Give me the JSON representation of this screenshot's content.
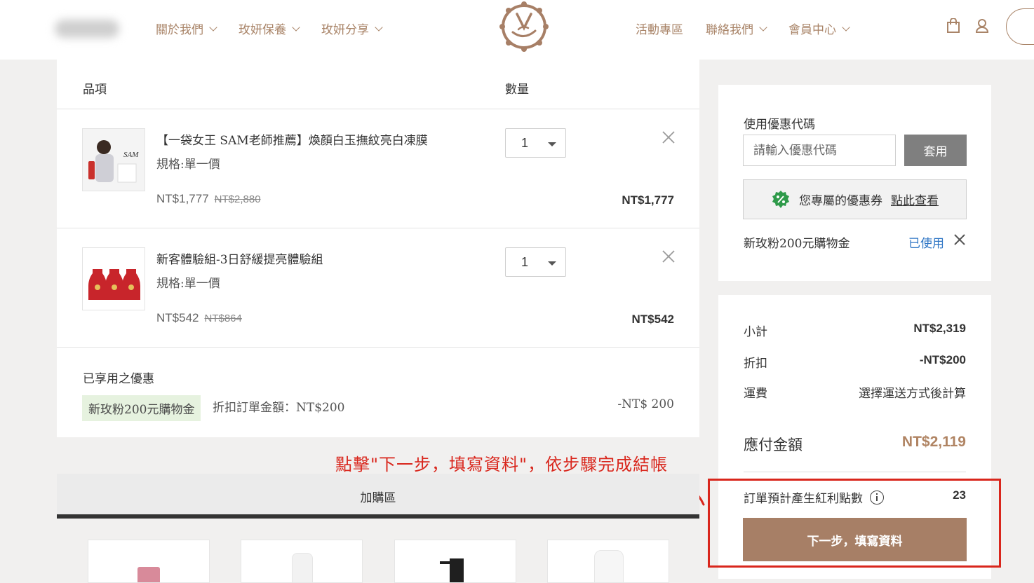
{
  "header": {
    "nav_left": [
      {
        "label": "關於我們"
      },
      {
        "label": "玫妍保養"
      },
      {
        "label": "玫妍分享"
      }
    ],
    "nav_right": [
      {
        "label": "活動專區"
      },
      {
        "label": "聯絡我們"
      },
      {
        "label": "會員中心"
      }
    ]
  },
  "cart": {
    "col_item": "品項",
    "col_qty": "數量",
    "items": [
      {
        "name": "【一袋女王 SAM老師推薦】煥顏白玉撫紋亮白凍膜",
        "spec": "規格:單一價",
        "price": "NT$1,777",
        "original_price": "NT$2,880",
        "qty": "1",
        "line_total": "NT$1,777",
        "thumb_text": "SAM"
      },
      {
        "name": "新客體驗組-3日舒緩提亮體驗組",
        "spec": "規格:單一價",
        "price": "NT$542",
        "original_price": "NT$864",
        "qty": "1",
        "line_total": "NT$542"
      }
    ],
    "applied": {
      "title": "已享用之優惠",
      "tag": "新玫粉200元購物金",
      "desc": "折扣訂單金額：NT$200",
      "amount": "-NT$ 200"
    }
  },
  "annotation": {
    "text": "點擊\"下一步，填寫資料\"，依步驟完成結帳"
  },
  "addon": {
    "label": "加購區"
  },
  "coupon": {
    "title": "使用優惠代碼",
    "placeholder": "請輸入優惠代碼",
    "apply": "套用",
    "my_coupon_text": "您專屬的優惠券",
    "my_coupon_link": "點此查看",
    "used_name": "新玫粉200元購物金",
    "used_status": "已使用"
  },
  "summary": {
    "subtotal_label": "小計",
    "subtotal": "NT$2,319",
    "discount_label": "折扣",
    "discount": "-NT$200",
    "shipping_label": "運費",
    "shipping": "選擇運送方式後計算",
    "total_label": "應付金額",
    "total": "NT$2,119",
    "points_label": "訂單預計產生紅利點數",
    "points": "23",
    "next_button": "下一步，填寫資料"
  },
  "colors": {
    "brand": "#a77f66",
    "nav_text": "#a98468",
    "annotation_red": "#d9261c",
    "link_blue": "#2f76c5",
    "discount_tag_bg": "#e6f2df"
  }
}
